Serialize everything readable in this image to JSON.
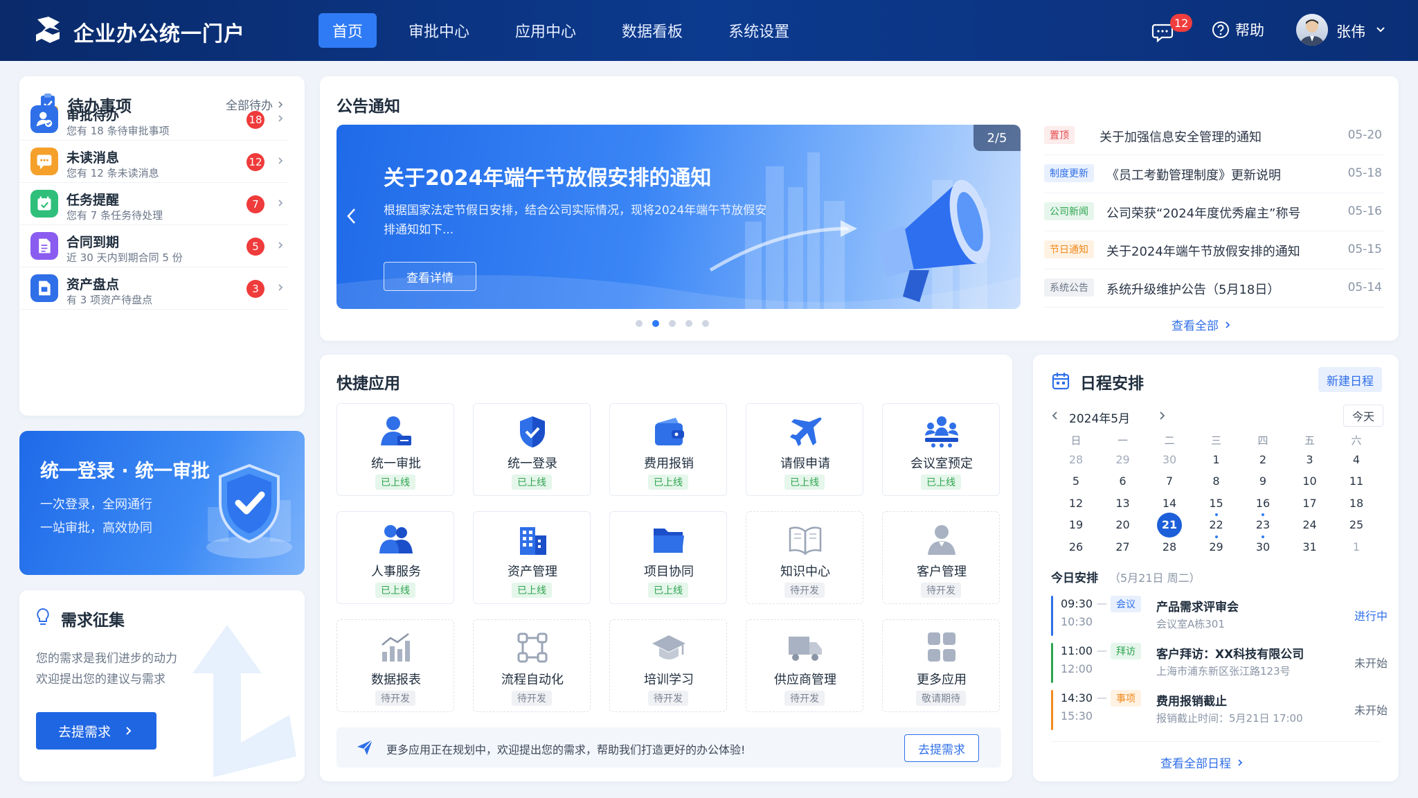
{
  "header": {
    "brand": "企业办公统一门户",
    "nav": [
      "首页",
      "审批中心",
      "应用中心",
      "数据看板",
      "系统设置"
    ],
    "active_nav": 0,
    "message_count": "12",
    "help_label": "帮助",
    "user_name": "张伟"
  },
  "todo": {
    "title": "待办事项",
    "more": "全部待办",
    "items": [
      {
        "title": "审批待办",
        "sub": "您有 18 条待审批事项",
        "count": "18",
        "color": "#2f6fe8",
        "icon": "user-check-icon"
      },
      {
        "title": "未读消息",
        "sub": "您有 12 条未读消息",
        "count": "12",
        "color": "#f5a02a",
        "icon": "message-icon"
      },
      {
        "title": "任务提醒",
        "sub": "您有 7 条任务待处理",
        "count": "7",
        "color": "#2fbf7a",
        "icon": "calendar-check-icon"
      },
      {
        "title": "合同到期",
        "sub": "近 30 天内到期合同 5 份",
        "count": "5",
        "color": "#8a5cf0",
        "icon": "document-icon"
      },
      {
        "title": "资产盘点",
        "sub": "有 3 项资产待盘点",
        "count": "3",
        "color": "#2f6fe8",
        "icon": "asset-icon"
      }
    ]
  },
  "sso": {
    "title": "统一登录 · 统一审批",
    "line1": "一次登录，全网通行",
    "line2": "一站审批，高效协同"
  },
  "demand": {
    "title": "需求征集",
    "line1": "您的需求是我们进步的动力",
    "line2": "欢迎提出您的建议与需求",
    "button": "去提需求"
  },
  "announcement": {
    "title": "公告通知",
    "banner": {
      "title": "关于2024年端午节放假安排的通知",
      "desc": "根据国家法定节假日安排，结合公司实际情况，现将2024年端午节放假安排通知如下...",
      "button": "查看详情",
      "page": "2/5"
    },
    "dots_total": 5,
    "dots_active": 1,
    "items": [
      {
        "tag": "置顶",
        "text": "关于加强信息安全管理的通知",
        "date": "05-20",
        "tag_bg": "#fdecec",
        "tag_fg": "#e5484d"
      },
      {
        "tag": "制度更新",
        "text": "《员工考勤管理制度》更新说明",
        "date": "05-18",
        "tag_bg": "#e8f0fe",
        "tag_fg": "#2f6fe8"
      },
      {
        "tag": "公司新闻",
        "text": "公司荣获“2024年度优秀雇主”称号",
        "date": "05-16",
        "tag_bg": "#e6f6ec",
        "tag_fg": "#2ea44f"
      },
      {
        "tag": "节日通知",
        "text": "关于2024年端午节放假安排的通知",
        "date": "05-15",
        "tag_bg": "#fff2e3",
        "tag_fg": "#f08a1c"
      },
      {
        "tag": "系统公告",
        "text": "系统升级维护公告（5月18日）",
        "date": "05-14",
        "tag_bg": "#f0f1f4",
        "tag_fg": "#6b7789"
      }
    ],
    "view_all": "查看全部"
  },
  "apps": {
    "title": "快捷应用",
    "items": [
      {
        "name": "统一审批",
        "status": "已上线",
        "online": true,
        "icon": "user-approve-icon"
      },
      {
        "name": "统一登录",
        "status": "已上线",
        "online": true,
        "icon": "shield-check-icon"
      },
      {
        "name": "费用报销",
        "status": "已上线",
        "online": true,
        "icon": "wallet-icon"
      },
      {
        "name": "请假申请",
        "status": "已上线",
        "online": true,
        "icon": "plane-icon"
      },
      {
        "name": "会议室预定",
        "status": "已上线",
        "online": true,
        "icon": "meeting-icon"
      },
      {
        "name": "人事服务",
        "status": "已上线",
        "online": true,
        "icon": "users-icon"
      },
      {
        "name": "资产管理",
        "status": "已上线",
        "online": true,
        "icon": "building-icon"
      },
      {
        "name": "项目协同",
        "status": "已上线",
        "online": true,
        "icon": "folder-icon"
      },
      {
        "name": "知识中心",
        "status": "待开发",
        "online": false,
        "icon": "book-icon"
      },
      {
        "name": "客户管理",
        "status": "待开发",
        "online": false,
        "icon": "customer-icon"
      },
      {
        "name": "数据报表",
        "status": "待开发",
        "online": false,
        "icon": "chart-icon"
      },
      {
        "name": "流程自动化",
        "status": "待开发",
        "online": false,
        "icon": "workflow-icon"
      },
      {
        "name": "培训学习",
        "status": "待开发",
        "online": false,
        "icon": "graduation-icon"
      },
      {
        "name": "供应商管理",
        "status": "待开发",
        "online": false,
        "icon": "truck-icon"
      },
      {
        "name": "更多应用",
        "status": "敬请期待",
        "online": false,
        "icon": "grid-icon"
      }
    ],
    "notice": "更多应用正在规划中，欢迎提出您的需求，帮助我们打造更好的办公体验!",
    "notice_button": "去提需求"
  },
  "schedule": {
    "title": "日程安排",
    "new_button": "新建日程",
    "month": "2024年5月",
    "today_button": "今天",
    "weekdays": [
      "日",
      "一",
      "二",
      "三",
      "四",
      "五",
      "六"
    ],
    "days": [
      [
        "28",
        "29",
        "30",
        "1",
        "2",
        "3",
        "4"
      ],
      [
        "5",
        "6",
        "7",
        "8",
        "9",
        "10",
        "11"
      ],
      [
        "12",
        "13",
        "14",
        "15",
        "16",
        "17",
        "18"
      ],
      [
        "19",
        "20",
        "21",
        "22",
        "23",
        "24",
        "25"
      ],
      [
        "26",
        "27",
        "28",
        "29",
        "30",
        "31",
        "1"
      ]
    ],
    "today": "21",
    "today_label": "今日安排",
    "today_date": "（5月21日 周二）",
    "events": [
      {
        "start": "09:30",
        "end": "10:30",
        "tag": "会议",
        "title": "产品需求评审会",
        "sub": "会议室A栋301",
        "status": "进行中",
        "color": "#2f6fe8",
        "tag_bg": "#e8f0fe",
        "status_color": "#2f6fe8"
      },
      {
        "start": "11:00",
        "end": "12:00",
        "tag": "拜访",
        "title": "客户拜访：XX科技有限公司",
        "sub": "上海市浦东新区张江路123号",
        "status": "未开始",
        "color": "#2ea44f",
        "tag_bg": "#e6f6ec",
        "status_color": "#5e6b7d"
      },
      {
        "start": "14:30",
        "end": "15:30",
        "tag": "事项",
        "title": "费用报销截止",
        "sub": "报销截止时间：5月21日 17:00",
        "status": "未开始",
        "color": "#f08a1c",
        "tag_bg": "#fff2e3",
        "status_color": "#5e6b7d"
      }
    ],
    "view_all": "查看全部日程"
  }
}
